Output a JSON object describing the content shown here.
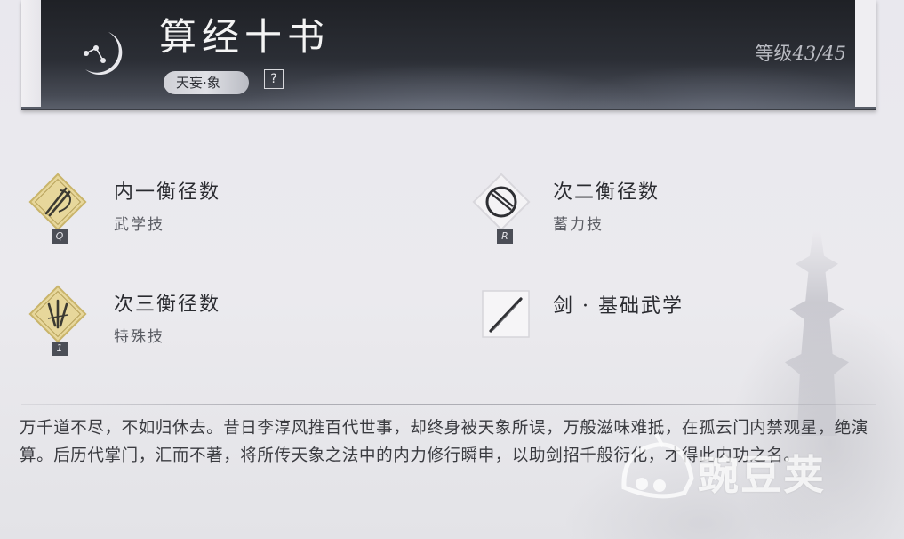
{
  "header": {
    "title": "算经十书",
    "subtag": "天妄·象",
    "help_label": "?",
    "level_prefix": "等级",
    "level_value": "43/45"
  },
  "skills": [
    {
      "name": "内一衡径数",
      "type": "武学技",
      "key": "Q",
      "icon": "diamond-brush-icon"
    },
    {
      "name": "次二衡径数",
      "type": "蓄力技",
      "key": "R",
      "icon": "diamond-ring-icon"
    },
    {
      "name": "次三衡径数",
      "type": "特殊技",
      "key": "1",
      "icon": "diamond-claw-icon"
    },
    {
      "name": "剑 · 基础武学",
      "type": "",
      "key": "",
      "icon": "sword-icon"
    }
  ],
  "description": "万千道不尽，不如归休去。昔日李淳风推百代世事，却终身被天象所误，万般滋味难抵，在孤云门内禁观星，绝演算。后历代掌门，汇而不著，将所传天象之法中的内力修行瞬申，以助剑招千般衍化，才得此内功之名。",
  "watermark": {
    "text": "豌豆荚"
  },
  "colors": {
    "gold": "#e8d79a",
    "header_dark": "#24262c",
    "text": "#2a2b30"
  }
}
